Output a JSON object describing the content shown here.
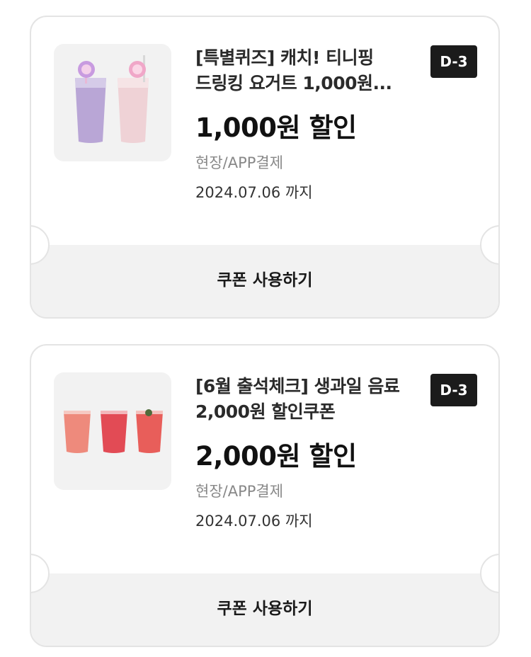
{
  "coupons": [
    {
      "title_line1": "[특별퀴즈] 캐치! 티니핑",
      "title_line2": "드링킹 요거트 1,000원...",
      "badge": "D-3",
      "discount": "1,000원 할인",
      "payment_method": "현장/APP결제",
      "expiry": "2024.07.06 까지",
      "action_label": "쿠폰 사용하기",
      "image": "drinking-yogurt-cups-icon"
    },
    {
      "title_line1": "[6월 출석체크] 생과일 음료",
      "title_line2": "2,000원 할인쿠폰",
      "badge": "D-3",
      "discount": "2,000원 할인",
      "payment_method": "현장/APP결제",
      "expiry": "2024.07.06 까지",
      "action_label": "쿠폰 사용하기",
      "image": "fresh-fruit-drinks-icon"
    }
  ],
  "colors": {
    "badge_bg": "#1b1b1b",
    "action_bg": "#f2f2f2",
    "border": "#e4e4e4"
  }
}
